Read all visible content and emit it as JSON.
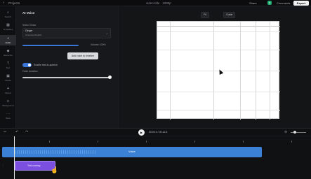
{
  "topbar": {
    "back_icon": "chevron-left-icon",
    "project": "Projects",
    "title": "video-title · 1080p",
    "buttons": [
      "Share",
      "Comments"
    ],
    "avatar": "A",
    "export_label": "Export"
  },
  "sidebar": {
    "items": [
      {
        "label": "Search",
        "icon": "search-icon"
      },
      {
        "label": "Templates",
        "icon": "grid-icon"
      },
      {
        "label": "Upload",
        "icon": "upload-icon"
      },
      {
        "label": "Audio",
        "icon": "music-icon",
        "active": true
      },
      {
        "label": "Elements",
        "icon": "shapes-icon"
      },
      {
        "label": "Text",
        "icon": "text-icon"
      },
      {
        "label": "Media",
        "icon": "image-icon"
      },
      {
        "label": "Brand",
        "icon": "brand-icon"
      },
      {
        "label": "Background",
        "icon": "layers-icon"
      },
      {
        "label": "More",
        "icon": "dots-icon"
      }
    ]
  },
  "panel": {
    "title": "AI Voice",
    "voice_label": "Select Voice",
    "voice_value": "Ginger",
    "voice_sub": "American English",
    "volume_label": "Volume 100%",
    "volume_level": 0.65,
    "tooltip": "Add voice to timeline",
    "toggle_label": "Enable text-to-speech",
    "toggle_on": true,
    "fade_label": "Fade duration",
    "fade_level": 1.0
  },
  "stage": {
    "buttons": [
      "Fit",
      "Guide"
    ],
    "accent": "#3b82d6"
  },
  "timeline": {
    "time": "00:00.0 / 00:12.5",
    "main_track_label": "Voice",
    "text_track_label": "Text overlay",
    "track_color": "#3b82d6",
    "text_track_color": "#7b4fe0",
    "zoom_icon": "zoom-icon"
  }
}
